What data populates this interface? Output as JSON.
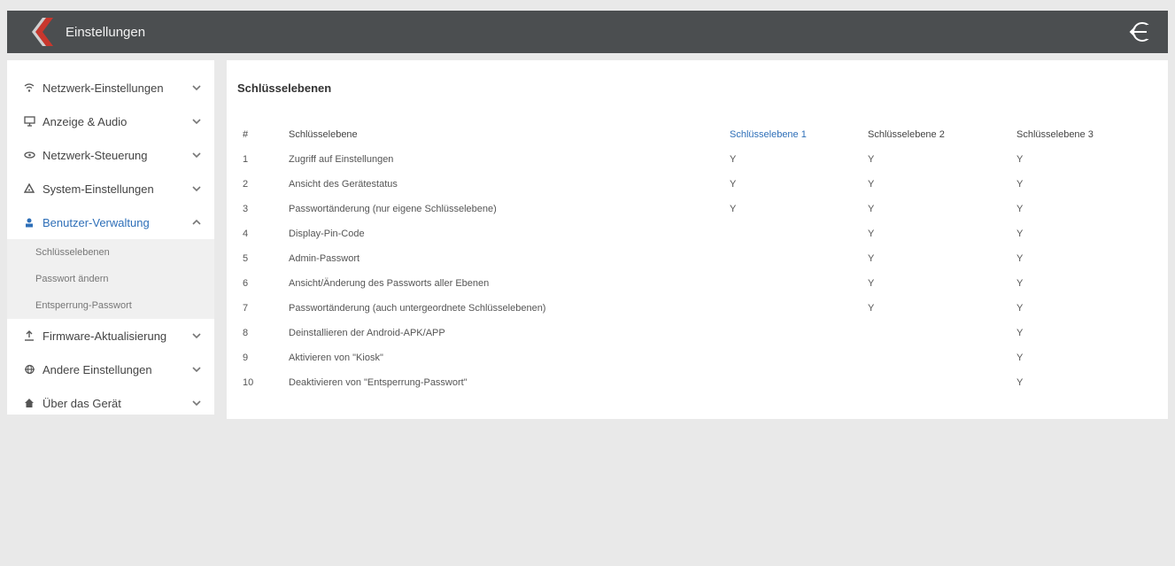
{
  "app": {
    "title": "Einstellungen"
  },
  "sidebar": {
    "items": [
      {
        "label": "Netzwerk-Einstellungen",
        "icon": "wifi-icon",
        "expanded": false
      },
      {
        "label": "Anzeige & Audio",
        "icon": "monitor-icon",
        "expanded": false
      },
      {
        "label": "Netzwerk-Steuerung",
        "icon": "network-icon",
        "expanded": false
      },
      {
        "label": "System-Einstellungen",
        "icon": "gear-icon",
        "expanded": false
      },
      {
        "label": "Benutzer-Verwaltung",
        "icon": "user-icon",
        "expanded": true
      },
      {
        "label": "Firmware-Aktualisierung",
        "icon": "upload-icon",
        "expanded": false
      },
      {
        "label": "Andere Einstellungen",
        "icon": "globe-icon",
        "expanded": false
      },
      {
        "label": "Über das Gerät",
        "icon": "home-icon",
        "expanded": false
      }
    ],
    "subitems": [
      "Schlüsselebenen",
      "Passwort ändern",
      "Entsperrung-Passwort"
    ]
  },
  "main": {
    "title": "Schlüsselebenen",
    "table": {
      "headers": [
        "#",
        "Schlüsselebene",
        "Schlüsselebene 1",
        "Schlüsselebene 2",
        "Schlüsselebene 3"
      ],
      "highlight_color": "#2e6fb8",
      "rows": [
        [
          "1",
          "Zugriff auf Einstellungen",
          "Y",
          "Y",
          "Y"
        ],
        [
          "2",
          "Ansicht des Gerätestatus",
          "Y",
          "Y",
          "Y"
        ],
        [
          "3",
          "Passwortänderung (nur eigene Schlüsselebene)",
          "Y",
          "Y",
          "Y"
        ],
        [
          "4",
          "Display-Pin-Code",
          "",
          "Y",
          "Y"
        ],
        [
          "5",
          "Admin-Passwort",
          "",
          "Y",
          "Y"
        ],
        [
          "6",
          "Ansicht/Änderung des Passworts aller Ebenen",
          "",
          "Y",
          "Y"
        ],
        [
          "7",
          "Passwortänderung (auch untergeordnete Schlüsselebenen)",
          "",
          "Y",
          "Y"
        ],
        [
          "8",
          "Deinstallieren der Android-APK/APP",
          "",
          "",
          "Y"
        ],
        [
          "9",
          "Aktivieren von \"Kiosk\"",
          "",
          "",
          "Y"
        ],
        [
          "10",
          "Deaktivieren von \"Entsperrung-Passwort\"",
          "",
          "",
          "Y"
        ]
      ]
    }
  }
}
